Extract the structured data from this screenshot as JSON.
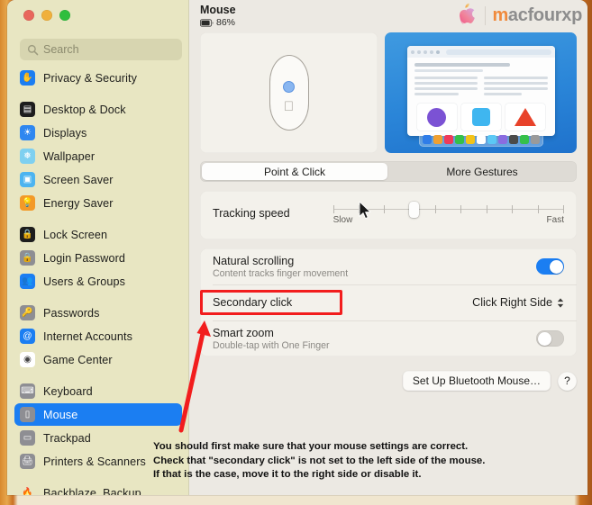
{
  "window": {
    "traffic_lights": [
      "close",
      "minimize",
      "zoom"
    ]
  },
  "sidebar": {
    "search": {
      "placeholder": "Search",
      "icon": "search-icon"
    },
    "groups": [
      {
        "items": [
          {
            "label": "Privacy & Security",
            "icon": "hand-icon",
            "color": "#1b7ef2",
            "glyph": "✋",
            "selected": false
          }
        ]
      },
      {
        "items": [
          {
            "label": "Desktop & Dock",
            "icon": "desktop-dock-icon",
            "color": "#1d1d1d",
            "glyph": "▤",
            "selected": false
          },
          {
            "label": "Displays",
            "icon": "displays-icon",
            "color": "#2f87f0",
            "glyph": "☀",
            "selected": false
          },
          {
            "label": "Wallpaper",
            "icon": "wallpaper-icon",
            "color": "#7fd0f0",
            "glyph": "❅",
            "selected": false
          },
          {
            "label": "Screen Saver",
            "icon": "screen-saver-icon",
            "color": "#4db4f0",
            "glyph": "▣",
            "selected": false
          },
          {
            "label": "Energy Saver",
            "icon": "energy-saver-icon",
            "color": "#f39a28",
            "glyph": "💡",
            "selected": false
          }
        ]
      },
      {
        "items": [
          {
            "label": "Lock Screen",
            "icon": "lock-screen-icon",
            "color": "#1d1d1d",
            "glyph": "🔒",
            "selected": false
          },
          {
            "label": "Login Password",
            "icon": "login-password-icon",
            "color": "#8e8e93",
            "glyph": "🔒",
            "selected": false
          },
          {
            "label": "Users & Groups",
            "icon": "users-groups-icon",
            "color": "#1b7ef2",
            "glyph": "👥",
            "selected": false
          }
        ]
      },
      {
        "items": [
          {
            "label": "Passwords",
            "icon": "passwords-icon",
            "color": "#8e8e93",
            "glyph": "🔑",
            "selected": false
          },
          {
            "label": "Internet Accounts",
            "icon": "internet-accounts-icon",
            "color": "#1b7ef2",
            "glyph": "@",
            "selected": false
          },
          {
            "label": "Game Center",
            "icon": "game-center-icon",
            "color": "#ffffff",
            "glyph": "◉",
            "selected": false
          }
        ]
      },
      {
        "items": [
          {
            "label": "Keyboard",
            "icon": "keyboard-icon",
            "color": "#8e8e93",
            "glyph": "⌨",
            "selected": false
          },
          {
            "label": "Mouse",
            "icon": "mouse-icon",
            "color": "#8e8e93",
            "glyph": "▯",
            "selected": true
          },
          {
            "label": "Trackpad",
            "icon": "trackpad-icon",
            "color": "#8e8e93",
            "glyph": "▭",
            "selected": false
          },
          {
            "label": "Printers & Scanners",
            "icon": "printers-scanners-icon",
            "color": "#8e8e93",
            "glyph": "🖨",
            "selected": false
          }
        ]
      },
      {
        "items": [
          {
            "label": "Backblaze_Backup",
            "icon": "backblaze-flame-icon",
            "color": "transparent",
            "glyph": "🔥",
            "selected": false
          }
        ]
      }
    ]
  },
  "header": {
    "title": "Mouse",
    "battery_percent": "86%",
    "battery_icon": "battery-icon",
    "watermark_text_m": "m",
    "watermark_text_rest": "acfourxp",
    "watermark_logo": "apple-logo-icon"
  },
  "preview": {
    "mouse_illustration": "magic-mouse-illustration",
    "video_preview": "gesture-video-preview",
    "dock_colors": [
      "#2f7de8",
      "#f0a030",
      "#ef3a5a",
      "#35c04a",
      "#f3c318",
      "#ffffff",
      "#5bc8f5",
      "#8a6ce0",
      "#4a4a4a",
      "#35c04a",
      "#9a9a9a"
    ],
    "shape_circle_color": "#7b52d4",
    "shape_square_color": "#3fb6f0",
    "shape_triangle_color": "#e8422a"
  },
  "tabs": [
    {
      "label": "Point & Click",
      "active": true
    },
    {
      "label": "More Gestures",
      "active": false
    }
  ],
  "tracking_speed": {
    "label": "Tracking speed",
    "slow_label": "Slow",
    "fast_label": "Fast",
    "tick_count": 10,
    "value_percent": 33
  },
  "settings": [
    {
      "name": "natural-scrolling",
      "title": "Natural scrolling",
      "subtitle": "Content tracks finger movement",
      "control": "toggle",
      "state": "on"
    },
    {
      "name": "secondary-click",
      "title": "Secondary click",
      "subtitle": "",
      "control": "popup",
      "value": "Click Right Side",
      "highlighted": true
    },
    {
      "name": "smart-zoom",
      "title": "Smart zoom",
      "subtitle": "Double-tap with One Finger",
      "control": "toggle",
      "state": "off"
    }
  ],
  "buttons": {
    "setup_bluetooth_mouse": "Set Up Bluetooth Mouse…",
    "help": "?"
  },
  "annotation": {
    "highlight_color": "#f21d1d",
    "text": "You should first make sure that your mouse settings are correct.\nCheck that \"secondary click\" is not set to the left side of the mouse.\nIf that is the case, move it to the right side or disable it."
  }
}
